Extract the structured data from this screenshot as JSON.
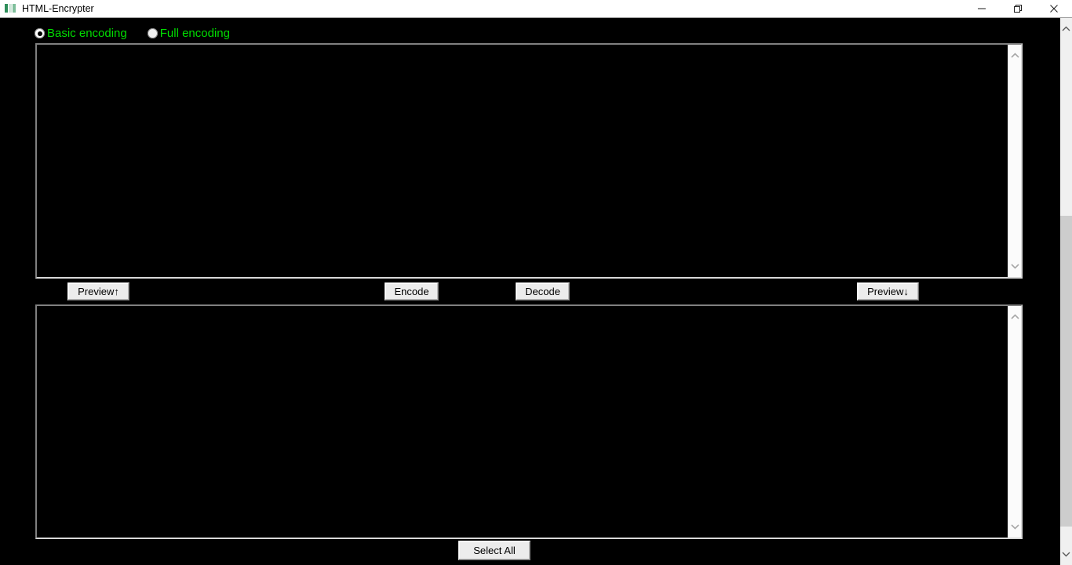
{
  "window": {
    "title": "HTML-Encrypter",
    "icon": "app-icon",
    "controls": {
      "minimize": "minimize-icon",
      "restore": "restore-icon",
      "close": "close-icon"
    }
  },
  "options": {
    "radios": [
      {
        "label": "Basic encoding",
        "checked": true
      },
      {
        "label": "Full encoding",
        "checked": false
      }
    ],
    "accent_color": "#00dd00"
  },
  "editors": {
    "input": {
      "name": "input-textarea",
      "value": "",
      "placeholder": ""
    },
    "output": {
      "name": "output-textarea",
      "value": "",
      "placeholder": ""
    }
  },
  "toolbar": {
    "preview_up": "Preview↑",
    "encode": "Encode",
    "decode": "Decode",
    "preview_down": "Preview↓"
  },
  "footer": {
    "select_all": "Select All"
  },
  "scrollbars": {
    "window": {
      "up": "chevron-up-icon",
      "down": "chevron-down-icon"
    },
    "editor": {
      "up": "chevron-up-icon",
      "down": "chevron-down-icon"
    }
  }
}
